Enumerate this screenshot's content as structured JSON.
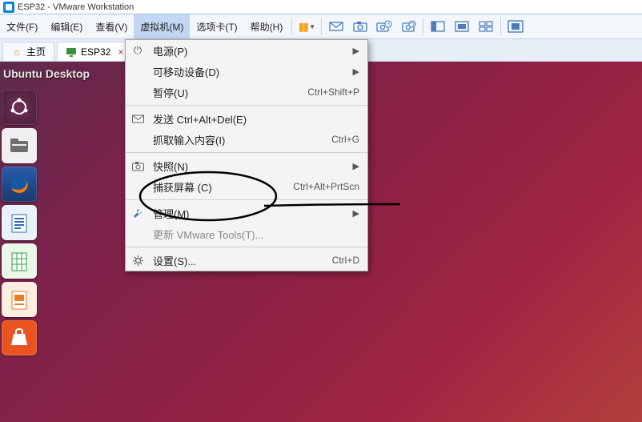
{
  "window": {
    "title": "ESP32 - VMware Workstation"
  },
  "menubar": {
    "file": "文件(F)",
    "edit": "编辑(E)",
    "view": "查看(V)",
    "vm": "虚拟机(M)",
    "tabs": "选项卡(T)",
    "help": "帮助(H)"
  },
  "tabs": {
    "home": "主页",
    "vm": "ESP32"
  },
  "guest": {
    "desktop_title": "Ubuntu Desktop"
  },
  "dropdown": {
    "power": {
      "label": "电源(P)"
    },
    "removable": {
      "label": "可移动设备(D)"
    },
    "pause": {
      "label": "暂停(U)",
      "short": "Ctrl+Shift+P"
    },
    "sendcad": {
      "label": "发送 Ctrl+Alt+Del(E)"
    },
    "grab": {
      "label": "抓取输入内容(I)",
      "short": "Ctrl+G"
    },
    "snapshot": {
      "label": "快照(N)"
    },
    "capture": {
      "label": "捕获屏幕 (C)",
      "short": "Ctrl+Alt+PrtScn"
    },
    "manage": {
      "label": "管理(M)"
    },
    "update_tools": {
      "label": "更新 VMware Tools(T)..."
    },
    "settings": {
      "label": "设置(S)...",
      "short": "Ctrl+D"
    }
  },
  "icon_glyphs": {
    "power": "⏻",
    "send": "✉",
    "snapshot": "⎙",
    "wrench": "🔧",
    "gear": "⚙",
    "home": "⌂",
    "monitor": "🖥",
    "pause1": "▮",
    "pause2": "▮"
  }
}
